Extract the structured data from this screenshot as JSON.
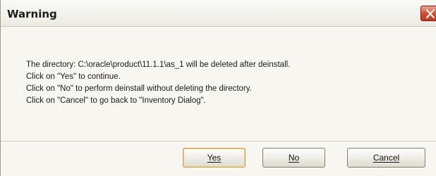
{
  "window": {
    "title": "Warning"
  },
  "message": {
    "lines": [
      "The directory: C:\\oracle\\product\\11.1.1\\as_1 will be deleted after deinstall.",
      "Click on \"Yes\" to continue.",
      "Click on \"No\" to perform deinstall without deleting the directory.",
      "Click on \"Cancel\" to go back to \"Inventory Dialog\"."
    ]
  },
  "buttons": {
    "yes": "Yes",
    "no": "No",
    "cancel": "Cancel"
  },
  "icons": {
    "close": "close-icon"
  },
  "colors": {
    "close_button": "#d8472a",
    "default_button_border": "#c9a44c"
  }
}
